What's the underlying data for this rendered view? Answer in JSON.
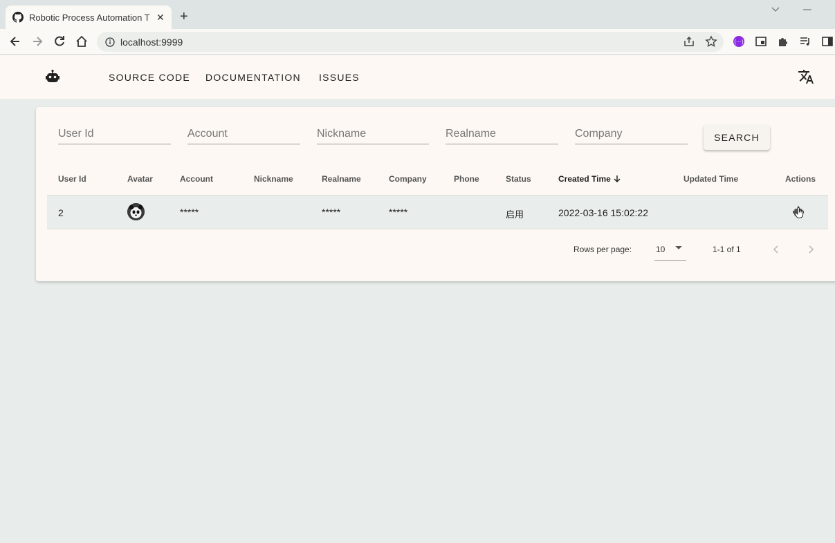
{
  "browser": {
    "tab_title": "Robotic Process Automation T",
    "url": "localhost:9999"
  },
  "appbar": {
    "links": [
      "SOURCE CODE",
      "DOCUMENTATION",
      "ISSUES"
    ]
  },
  "filters": {
    "user_id": "User Id",
    "account": "Account",
    "nickname": "Nickname",
    "realname": "Realname",
    "company": "Company",
    "search_label": "SEARCH"
  },
  "table": {
    "headers": [
      "User Id",
      "Avatar",
      "Account",
      "Nickname",
      "Realname",
      "Company",
      "Phone",
      "Status",
      "Created Time",
      "Updated Time",
      "Actions"
    ],
    "sorted_header_index": 8,
    "rows": [
      {
        "user_id": "2",
        "account": "*****",
        "nickname": "",
        "realname": "*****",
        "company": "*****",
        "phone": "",
        "status": "启用",
        "created_time": "2022-03-16 15:02:22",
        "updated_time": ""
      }
    ]
  },
  "pagination": {
    "rows_per_page_label": "Rows per page:",
    "rows_per_page": "10",
    "range": "1-1 of 1"
  },
  "colors": {
    "appbar_bg": "#fdf8f3",
    "page_bg": "#e8ecea",
    "row_highlight": "#e9edeb"
  }
}
